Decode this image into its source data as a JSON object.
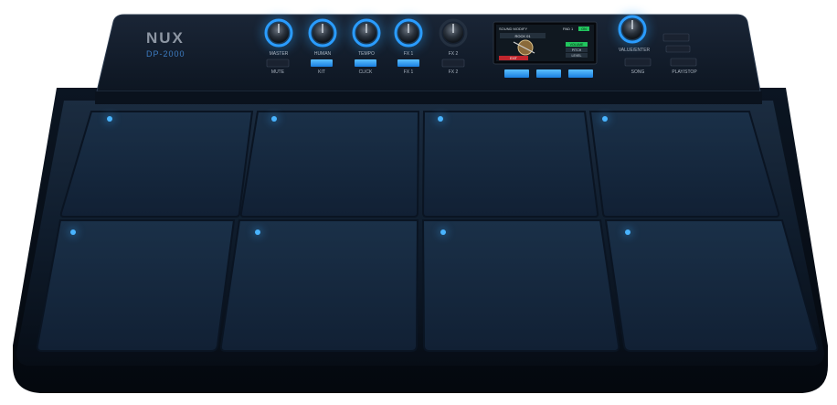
{
  "brand": {
    "logo": "NUX",
    "model": "DP-2000"
  },
  "knobs": [
    {
      "label": "MASTER"
    },
    {
      "label": "HUMAN"
    },
    {
      "label": "TEMPO"
    },
    {
      "label": "FX 1"
    },
    {
      "label": "FX 2"
    }
  ],
  "buttons": [
    {
      "label": "MUTE"
    },
    {
      "label": "KIT"
    },
    {
      "label": "CLICK"
    },
    {
      "label": "FX 1"
    },
    {
      "label": "FX 2"
    }
  ],
  "screen": {
    "header_left": "SOUND MODIFY",
    "header_right": "PAD 1",
    "badge": "ON",
    "name": "ROCK 01",
    "opt1": "VOLUME",
    "opt2": "PITCH",
    "opt3": "LEVEL",
    "exit": "EXIT"
  },
  "right_panel": {
    "knob_label": "VALUE/ENTER",
    "song_label": "SONG",
    "play_label": "PLAY/STOP"
  },
  "pads": [
    {
      "id": 1
    },
    {
      "id": 2
    },
    {
      "id": 3
    },
    {
      "id": 4
    },
    {
      "id": 5
    },
    {
      "id": 6
    },
    {
      "id": 7
    },
    {
      "id": 8
    }
  ],
  "colors": {
    "body": "#0d1a2a",
    "pad": "#15263a",
    "accent": "#2a9cff",
    "led": "#49b4ff"
  }
}
